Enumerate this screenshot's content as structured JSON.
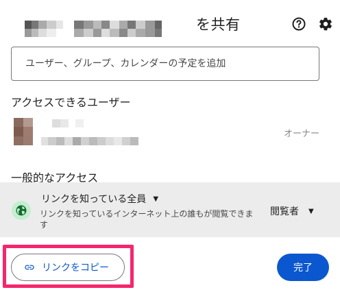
{
  "dialog": {
    "title_suffix": "を共有",
    "help_icon": "help-circle-icon",
    "settings_icon": "gear-icon"
  },
  "add_people": {
    "placeholder": "ユーザー、グループ、カレンダーの予定を追加"
  },
  "people_with_access": {
    "heading": "アクセスできるユーザー",
    "owner": {
      "role": "オーナー"
    }
  },
  "general_access": {
    "heading": "一般的なアクセス",
    "icon": "globe-icon",
    "setting": "リンクを知っている全員",
    "description": "リンクを知っているインターネット上の誰もが閲覧できます",
    "role": "閲覧者"
  },
  "footer": {
    "copy_link_label": "リンクをコピー",
    "done_label": "完了"
  },
  "colors": {
    "accent": "#0b57d0",
    "highlight": "#f5266d",
    "globe_bg": "#c4eed0",
    "access_bg": "#ececec"
  }
}
